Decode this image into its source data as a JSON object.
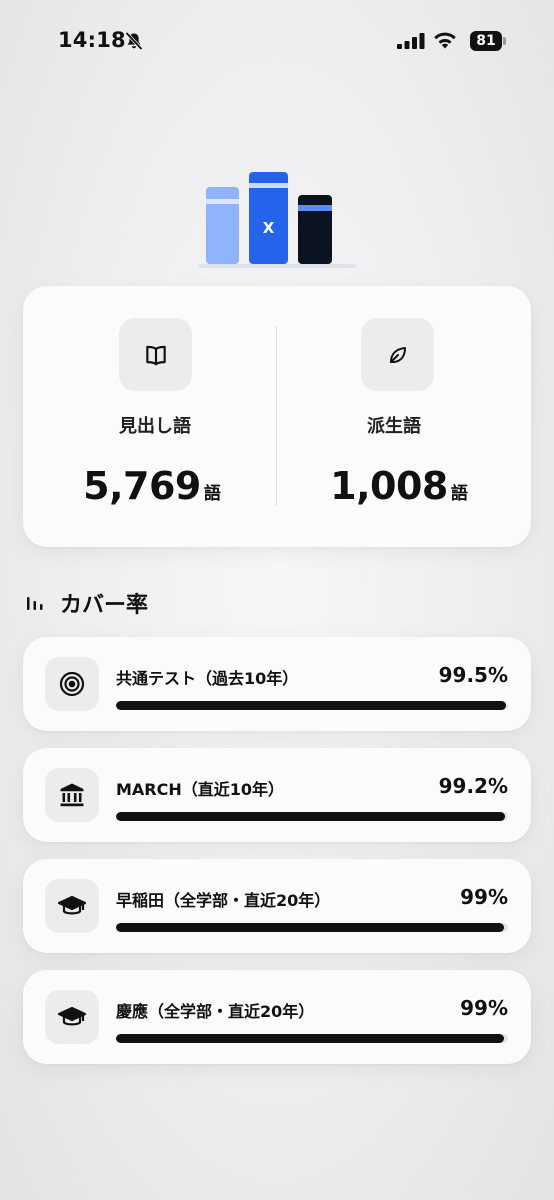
{
  "status": {
    "time": "14:18",
    "battery": "81",
    "icons": [
      "bell-slash-icon",
      "signal-icon",
      "wifi-icon",
      "battery-icon"
    ]
  },
  "hero": {
    "book_mark": "X",
    "colors": {
      "light_blue": "#8fb4fd",
      "blue": "#2563eb",
      "dark": "#0b1220"
    }
  },
  "stats": {
    "headwords": {
      "label": "見出し語",
      "value": "5,769",
      "unit": "語",
      "icon": "open-book-icon"
    },
    "derived": {
      "label": "派生語",
      "value": "1,008",
      "unit": "語",
      "icon": "leaf-icon"
    }
  },
  "coverage": {
    "title": "カバー率",
    "icon": "bar-chart-icon",
    "items": [
      {
        "label": "共通テスト（過去10年）",
        "pct": "99.5%",
        "value": 0.995,
        "icon": "target-icon"
      },
      {
        "label": "MARCH（直近10年）",
        "pct": "99.2%",
        "value": 0.992,
        "icon": "institution-icon"
      },
      {
        "label": "早稲田（全学部・直近20年）",
        "pct": "99%",
        "value": 0.99,
        "icon": "graduation-cap-icon"
      },
      {
        "label": "慶應（全学部・直近20年）",
        "pct": "99%",
        "value": 0.99,
        "icon": "graduation-cap-icon"
      }
    ]
  }
}
